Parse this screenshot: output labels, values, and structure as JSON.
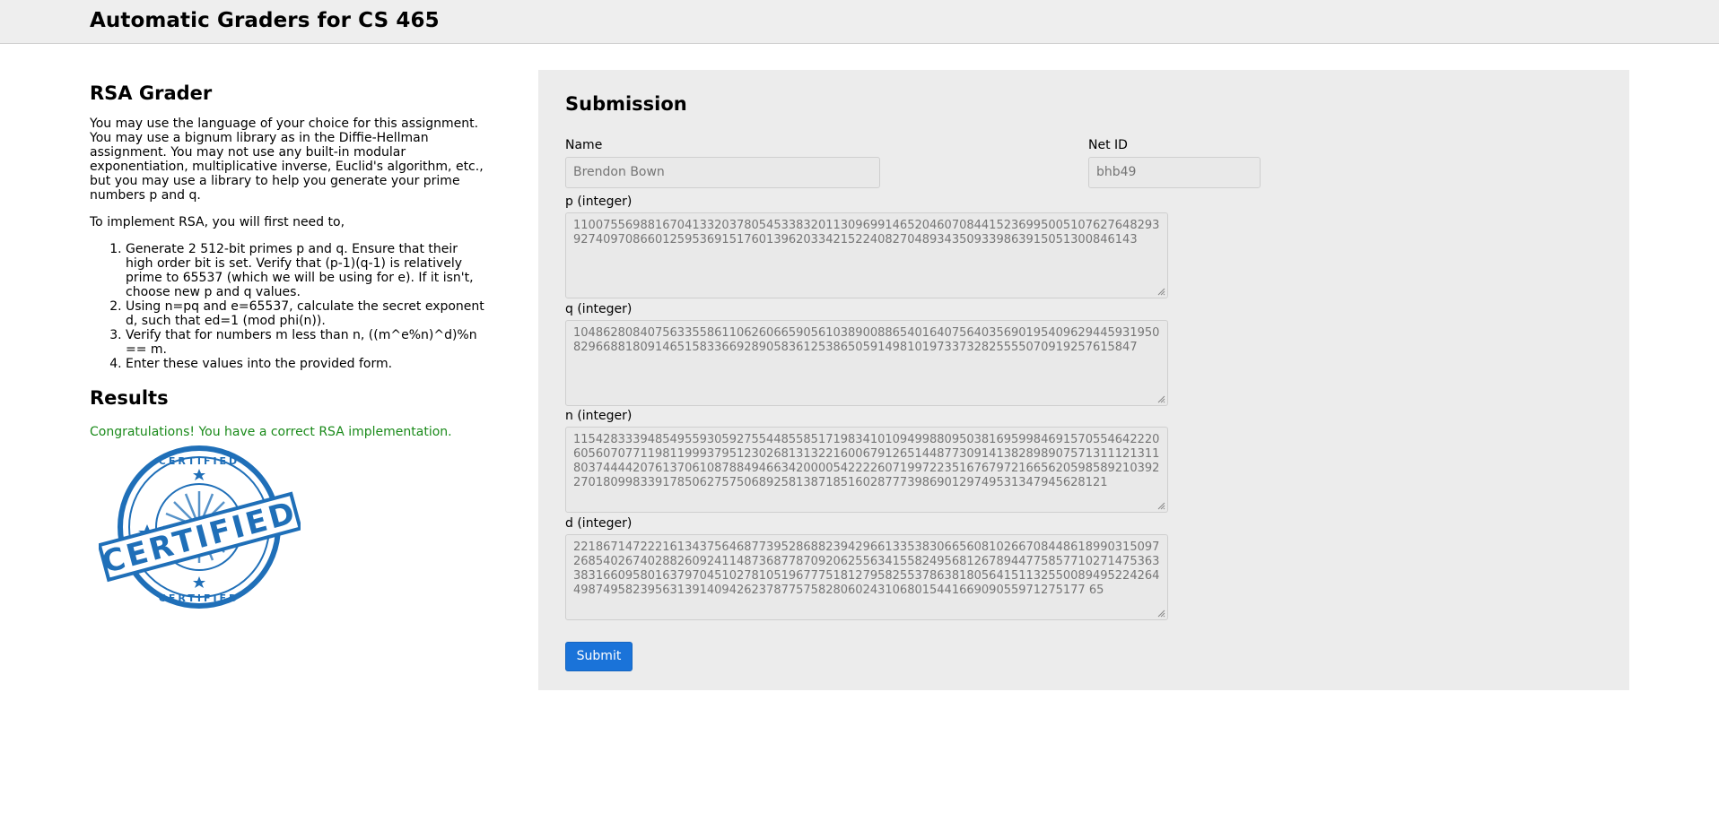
{
  "header": {
    "title": "Automatic Graders for CS 465"
  },
  "intro": {
    "heading": "RSA Grader",
    "paragraph": "You may use the language of your choice for this assignment. You may use a bignum library as in the Diffie-Hellman assignment. You may not use any built-in modular exponentiation, multiplicative inverse, Euclid's algorithm, etc., but you may use a library to help you generate your prime numbers p and q.",
    "steps_lead": "To implement RSA, you will first need to,",
    "steps": [
      "Generate 2 512-bit primes p and q. Ensure that their high order bit is set. Verify that (p-1)(q-1) is relatively prime to 65537 (which we will be using for e). If it isn't, choose new p and q values.",
      "Using n=pq and e=65537, calculate the secret exponent d, such that ed=1 (mod phi(n)).",
      "Verify that for numbers m less than n, ((m^e%n)^d)%n == m.",
      "Enter these values into the provided form."
    ]
  },
  "results": {
    "heading": "Results",
    "message": "Congratulations! You have a correct RSA implementation.",
    "stamp_text_large": "CERTIFIED",
    "stamp_text_small": "CERTIFIED"
  },
  "form": {
    "heading": "Submission",
    "name_label": "Name",
    "name_value": "Brendon Bown",
    "netid_label": "Net ID",
    "netid_value": "bhb49",
    "p_label": "p (integer)",
    "p_value": "11007556988167041332037805453383201130969914652046070844152369950051076276482939274097086601259536915176013962033421522408270489343509339863915051300846143",
    "q_label": "q (integer)",
    "q_value": "10486280840756335586110626066590561038900886540164075640356901954096294459319508296688180914651583366928905836125386505914981019733732825555070919257615847",
    "n_label": "n (integer)",
    "n_value": "115428333948549559305927554485585171983410109499880950381695998469157055464222060560707711981199937951230268131322160067912651448773091413828989075713111213118037444420761370610878849466342000054222260719972235167679721665620598589210392270180998339178506275750689258138718516028777398690129749531347945628121",
    "d_label": "d (integer)",
    "d_value": "221867147222161343756468773952868823942966133538306656081026670844861899031509726854026740288260924114873687787092062556341558249568126789447758577102714753633831660958016379704510278105196777518127958255378638180564151132550089495224264498749582395631391409426237877575828060243106801544166909055971275177 65",
    "submit_label": "Submit"
  },
  "colors": {
    "submit_button": "#1a73d9",
    "success_text": "#1a8a1a",
    "stamp": "#1f6fb8"
  }
}
